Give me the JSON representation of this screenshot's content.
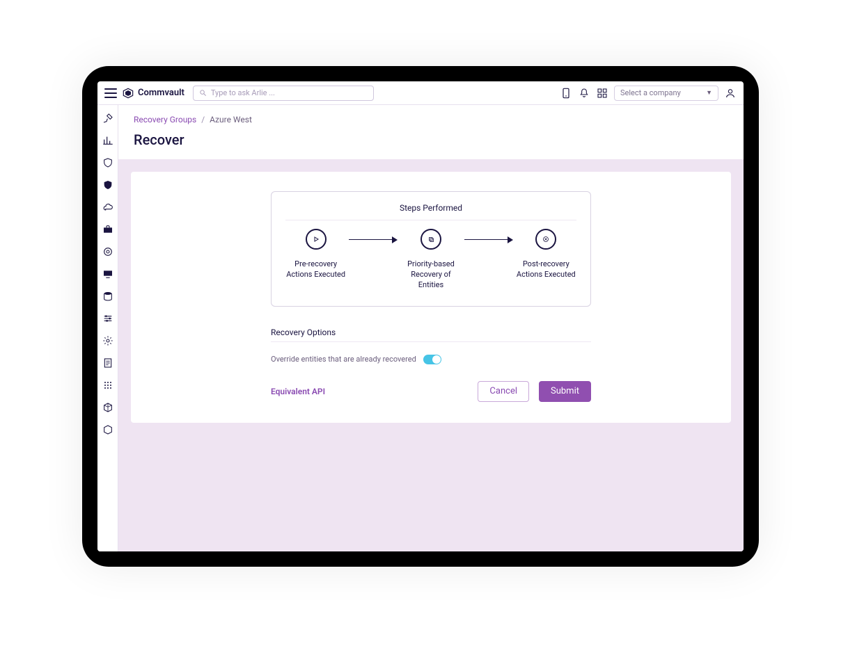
{
  "brand": {
    "name": "Commvault"
  },
  "search": {
    "placeholder": "Type to ask Arlie ..."
  },
  "company_select": {
    "placeholder": "Select a company"
  },
  "breadcrumb": {
    "root": "Recovery Groups",
    "current": "Azure West"
  },
  "page": {
    "title": "Recover"
  },
  "steps": {
    "heading": "Steps Performed",
    "items": [
      {
        "label": "Pre-recovery Actions Executed"
      },
      {
        "label": "Priority-based Recovery of Entities"
      },
      {
        "label": "Post-recovery Actions Executed"
      }
    ]
  },
  "recovery_options": {
    "heading": "Recovery Options",
    "override_label": "Override entities that are already recovered",
    "override_on": true
  },
  "actions": {
    "api_link": "Equivalent API",
    "cancel": "Cancel",
    "submit": "Submit"
  },
  "rail_icons": [
    "tools-icon",
    "chart-icon",
    "shield-outline-icon",
    "shield-solid-icon",
    "cloud-icon",
    "briefcase-icon",
    "target-icon",
    "monitor-icon",
    "database-icon",
    "sliders-icon",
    "gear-icon",
    "note-icon",
    "grid-icon",
    "cube-outline-icon",
    "cube-solid-icon"
  ]
}
